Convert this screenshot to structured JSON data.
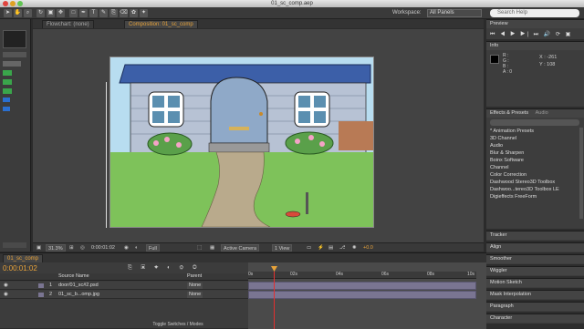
{
  "window": {
    "title": "01_sc_comp.aep"
  },
  "toolbar": {
    "workspace_label": "Workspace:",
    "workspace_value": "All Panels",
    "search_placeholder": "Search Help"
  },
  "viewer_tabs": {
    "flowchart": "Flowchart: (none)",
    "composition": "Composition: 01_sc_comp",
    "breadcrumb": "01_sc_comp"
  },
  "viewer_bar": {
    "zoom": "31.3%",
    "timecode": "0:00:01:02",
    "resolution": "Full",
    "camera": "Active Camera",
    "views": "1 View",
    "exposure": "+0.0"
  },
  "right": {
    "preview": "Preview",
    "info": "Info",
    "info_r": "R :",
    "info_g": "G :",
    "info_b": "B :",
    "info_a": "A : 0",
    "info_x": "X : -261",
    "info_y": "Y : 108",
    "effects_tab": "Effects & Presets",
    "audio_tab": "Audio",
    "search_placeholder": "",
    "fx_items": [
      "* Animation Presets",
      "3D Channel",
      "Audio",
      "Blur & Sharpen",
      "Boinx Software",
      "Channel",
      "Color Correction",
      "Dashwood Stereo3D Toolbox",
      "Dashwoo...tereo3D Toolbox LE",
      "Digieffects FreeForm"
    ],
    "panels": [
      "Tracker",
      "Align",
      "Smoother",
      "Wiggler",
      "Motion Sketch",
      "Mask Interpolation",
      "Paragraph",
      "Character"
    ]
  },
  "timeline": {
    "tab": "01_sc_comp",
    "timecode": "0:00:01:02",
    "col_source": "Source Name",
    "col_parent": "Parent",
    "ruler": [
      "0s",
      "02s",
      "04s",
      "06s",
      "08s",
      "10s"
    ],
    "layers": [
      {
        "num": "1",
        "name": "door/01_sc#2.psd",
        "parent": "None"
      },
      {
        "num": "2",
        "name": "01_sc_b...omp.jpg",
        "parent": "None"
      }
    ],
    "toggle": "Toggle Switches / Modes"
  },
  "colors": {
    "accent": "#e8a33a",
    "layer_bar": "#7a7592",
    "playhead": "#e23030"
  }
}
